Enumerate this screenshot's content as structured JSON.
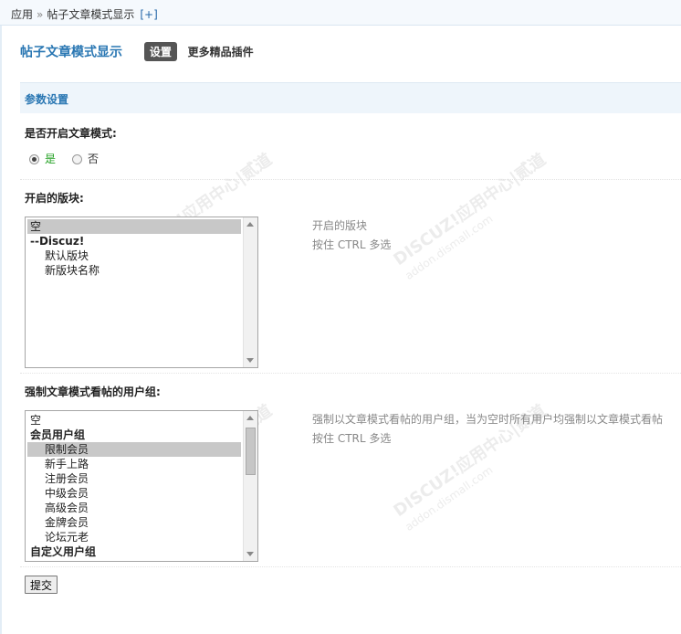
{
  "breadcrumb": {
    "root": "应用",
    "separator": "»",
    "current": "帖子文章模式显示",
    "add": "[+]"
  },
  "plugin": {
    "title": "帖子文章模式显示",
    "tab_settings": "设置",
    "more_link": "更多精品插件"
  },
  "section": {
    "title": "参数设置"
  },
  "article_mode": {
    "label": "是否开启文章模式:",
    "options": [
      {
        "label": "是",
        "checked": true
      },
      {
        "label": "否",
        "checked": false
      }
    ]
  },
  "forums": {
    "label": "开启的版块:",
    "options": [
      "空",
      "--Discuz!",
      "默认版块",
      "新版块名称"
    ],
    "selected": "空",
    "tip_line1": "开启的版块",
    "tip_line2": "按住 CTRL 多选"
  },
  "usergroups": {
    "label": "强制文章模式看帖的用户组:",
    "options": [
      "空",
      "会员用户组",
      "限制会员",
      "新手上路",
      "注册会员",
      "中级会员",
      "高级会员",
      "金牌会员",
      "论坛元老",
      "自定义用户组"
    ],
    "selected": "限制会员",
    "tip_line1": "强制以文章模式看帖的用户组，当为空时所有用户均强制以文章模式看帖",
    "tip_line2": "按住 CTRL 多选"
  },
  "submit_label": "提交",
  "watermark": {
    "brand": "DISCUZ!应用中心|贰道",
    "domain": "addon.dismall.com"
  },
  "colors": {
    "accent": "#2a77b3",
    "section_bg": "#eef5fb",
    "radio_yes": "#22a022"
  },
  "icons": {
    "radio": "radio-icon",
    "scroll_up": "chevron-up-icon",
    "scroll_down": "chevron-down-icon"
  }
}
